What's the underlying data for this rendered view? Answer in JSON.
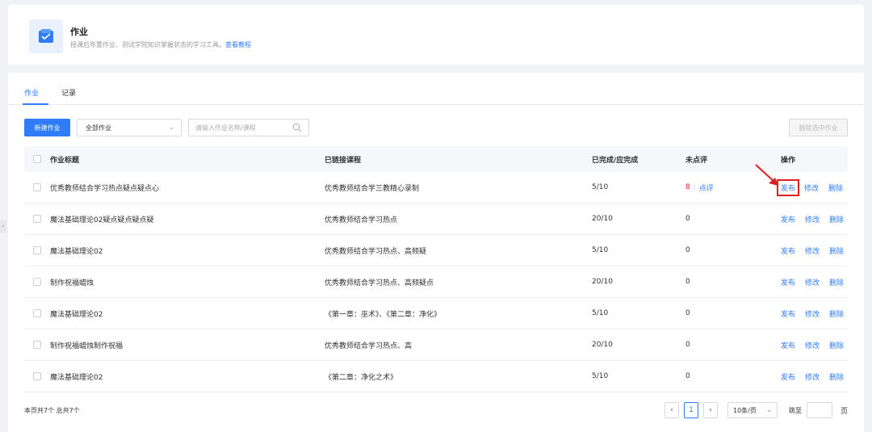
{
  "header": {
    "title": "作业",
    "desc": "授课后布置作业、测试学院知识掌握状态的学习工具。",
    "desc_link": "查看教程",
    "icon": "homework-icon"
  },
  "tabs": [
    {
      "label": "作业",
      "active": true
    },
    {
      "label": "记录",
      "active": false
    }
  ],
  "toolbar": {
    "new_label": "新建作业",
    "filter_value": "全部作业",
    "search_placeholder": "请输入作业名称/课程",
    "delete_selected_label": "删除选中作业"
  },
  "table": {
    "columns": [
      "作业标题",
      "已链接课程",
      "已完成/应完成",
      "未点评",
      "操作"
    ],
    "rows": [
      {
        "title": "优秀教师结合学习热点疑点疑点心",
        "course": "优秀教师结合学三教精心录制",
        "done": "5/10",
        "pending": "8",
        "review": "点评"
      },
      {
        "title": "魔法基础理论02疑点疑点疑点疑",
        "course": "优秀教师结合学习热点",
        "done": "20/10",
        "pending": "0"
      },
      {
        "title": "魔法基础理论02",
        "course": "优秀教师结合学习热点、高频疑",
        "done": "5/10",
        "pending": "0"
      },
      {
        "title": "制作祝福蜡烛",
        "course": "优秀教师结合学习热点、高频疑点",
        "done": "20/10",
        "pending": "0"
      },
      {
        "title": "魔法基础理论02",
        "course": "《第一章：巫术》、《第二章：净化》",
        "done": "5/10",
        "pending": "0"
      },
      {
        "title": "制作祝福蜡烛制作祝福",
        "course": "优秀教师结合学习热点、高",
        "done": "20/10",
        "pending": "0"
      },
      {
        "title": "魔法基础理论02",
        "course": "《第二章：净化之术》",
        "done": "5/10",
        "pending": "0"
      }
    ],
    "ops": {
      "publish": "发布",
      "edit": "修改",
      "delete": "删除"
    }
  },
  "footer": {
    "total": "本页共7个  总共7个",
    "current_page": "1",
    "page_size": "10条/页",
    "jump_label": "跳至",
    "page_unit": "页"
  },
  "colors": {
    "accent": "#2f7cf6",
    "danger": "#f5222d",
    "highlight_box": "#e02020"
  }
}
